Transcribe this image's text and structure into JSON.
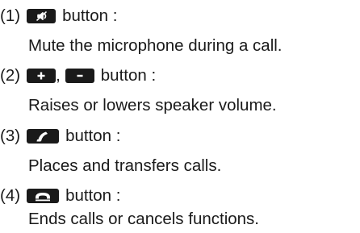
{
  "items": [
    {
      "number": "(1)",
      "keys": [
        "mute-key"
      ],
      "suffix": "button :",
      "description": "Mute the microphone during a call."
    },
    {
      "number": "(2)",
      "keys": [
        "plus-key",
        "minus-key"
      ],
      "separator": ",",
      "suffix": "button :",
      "description": "Raises or lowers speaker volume."
    },
    {
      "number": "(3)",
      "keys": [
        "call-key"
      ],
      "suffix": "button :",
      "description": "Places and transfers calls."
    },
    {
      "number": "(4)",
      "keys": [
        "end-call-key"
      ],
      "suffix": "button :",
      "description": "Ends calls or cancels functions."
    }
  ],
  "colors": {
    "text": "#1a1a1a",
    "key_background": "#1a1a1a",
    "key_symbol": "#ffffff"
  },
  "icons": [
    "mute-icon",
    "plus-icon",
    "minus-icon",
    "handset-pickup-icon",
    "handset-hangup-icon"
  ]
}
